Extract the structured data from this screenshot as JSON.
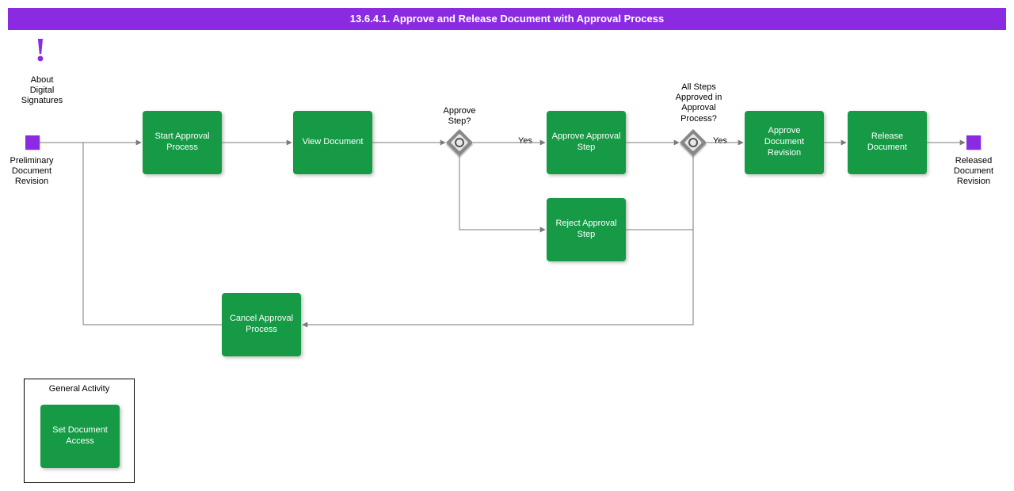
{
  "title": "13.6.4.1. Approve and Release Document with Approval Process",
  "info": {
    "label": "About\nDigital\nSignatures"
  },
  "start_event": {
    "label": "Preliminary\nDocument\nRevision"
  },
  "end_event": {
    "label": "Released\nDocument\nRevision"
  },
  "activities": {
    "start_approval": "Start Approval Process",
    "view_document": "View Document",
    "approve_step": "Approve Approval Step",
    "reject_step": "Reject Approval Step",
    "approve_revision": "Approve Document Revision",
    "release_document": "Release Document",
    "cancel_approval": "Cancel Approval Process",
    "set_access": "Set Document Access"
  },
  "gateways": {
    "approve_step_q": "Approve\nStep?",
    "all_approved_q": "All Steps\nApproved in\nApproval\nProcess?"
  },
  "edge_labels": {
    "yes1": "Yes",
    "yes2": "Yes"
  },
  "group": {
    "title": "General Activity"
  },
  "colors": {
    "accent": "#8a2be2",
    "activity": "#169a46",
    "edge": "#7a7a7a"
  }
}
